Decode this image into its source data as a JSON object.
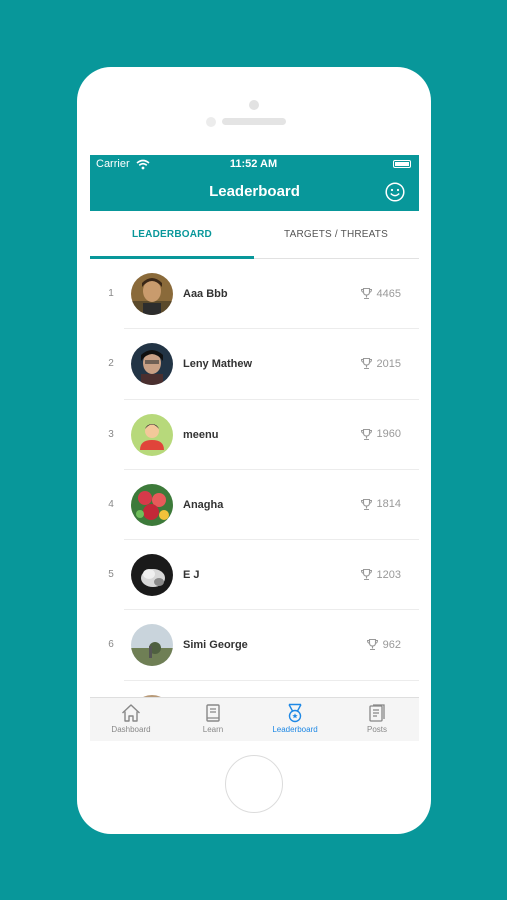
{
  "status_bar": {
    "carrier": "Carrier",
    "time": "11:52 AM"
  },
  "header": {
    "title": "Leaderboard"
  },
  "tabs": [
    {
      "label": "LEADERBOARD",
      "active": true
    },
    {
      "label": "TARGETS / THREATS",
      "active": false
    }
  ],
  "leaderboard": [
    {
      "rank": "1",
      "name": "Aaa Bbb",
      "score": "4465"
    },
    {
      "rank": "2",
      "name": "Leny Mathew",
      "score": "2015"
    },
    {
      "rank": "3",
      "name": "meenu",
      "score": "1960"
    },
    {
      "rank": "4",
      "name": "Anagha",
      "score": "1814"
    },
    {
      "rank": "5",
      "name": "E J",
      "score": "1203"
    },
    {
      "rank": "6",
      "name": "Simi George",
      "score": "962"
    }
  ],
  "tabbar": [
    {
      "label": "Dashboard",
      "icon": "home-icon"
    },
    {
      "label": "Learn",
      "icon": "book-icon"
    },
    {
      "label": "Leaderboard",
      "icon": "medal-icon",
      "active": true
    },
    {
      "label": "Posts",
      "icon": "posts-icon"
    }
  ],
  "colors": {
    "accent": "#08979a",
    "active_tab": "#1e88e5"
  }
}
